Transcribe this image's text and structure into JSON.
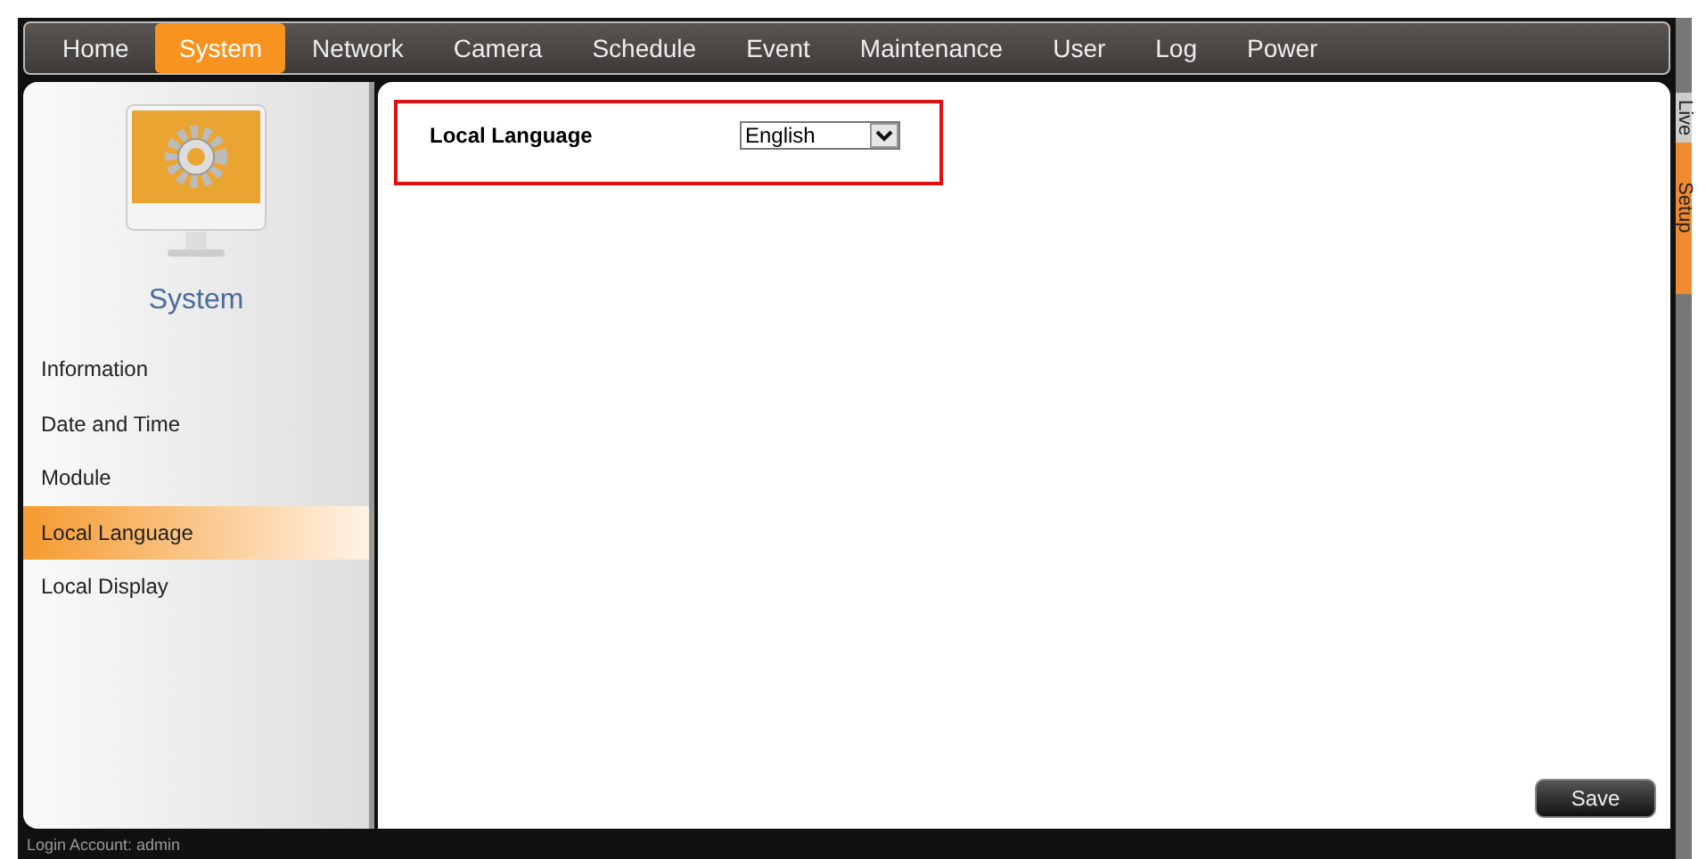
{
  "nav": [
    {
      "label": "Home",
      "selected": false
    },
    {
      "label": "System",
      "selected": true
    },
    {
      "label": "Network",
      "selected": false
    },
    {
      "label": "Camera",
      "selected": false
    },
    {
      "label": "Schedule",
      "selected": false
    },
    {
      "label": "Event",
      "selected": false
    },
    {
      "label": "Maintenance",
      "selected": false
    },
    {
      "label": "User",
      "selected": false
    },
    {
      "label": "Log",
      "selected": false
    },
    {
      "label": "Power",
      "selected": false
    }
  ],
  "side_tabs": [
    {
      "label": "Live",
      "selected": false
    },
    {
      "label": "Setup",
      "selected": true
    }
  ],
  "sidebar": {
    "title": "System",
    "items": [
      {
        "label": "Information",
        "selected": false
      },
      {
        "label": "Date and Time",
        "selected": false
      },
      {
        "label": "Module",
        "selected": false
      },
      {
        "label": "Local Language",
        "selected": true
      },
      {
        "label": "Local Display",
        "selected": false
      }
    ]
  },
  "form": {
    "label": "Local Language",
    "value": "English"
  },
  "save_button": "Save",
  "status_bar": "Login Account: admin"
}
